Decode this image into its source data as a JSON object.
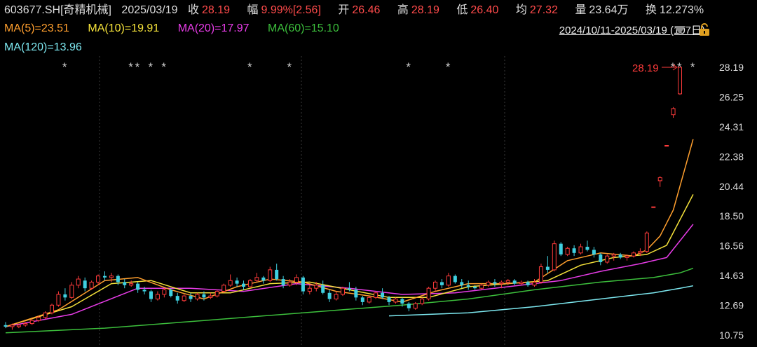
{
  "header": {
    "code": "603677.SH[奇精机械]",
    "date": "2025/03/19",
    "close_label": "收",
    "close": "28.19",
    "change_label": "幅",
    "change": "9.99%[2.56]",
    "open_label": "开",
    "open": "26.46",
    "high_label": "高",
    "high": "28.19",
    "low_label": "低",
    "low": "26.40",
    "avg_label": "均",
    "avg": "27.32",
    "vol_label": "量",
    "vol": "23.64万",
    "turnover_label": "换",
    "turnover": "12.273%"
  },
  "ma_legend": {
    "ma5": "MA(5)=23.51",
    "ma10": "MA(10)=19.91",
    "ma20": "MA(20)=17.97",
    "ma60": "MA(60)=15.10",
    "ma120": "MA(120)=13.96"
  },
  "range_label": "2024/10/11-2025/03/19 (107日)",
  "last_price_tag": "28.19",
  "colors": {
    "up": "#ff3b3b",
    "down": "#3fd0e0",
    "ma5": "#ff9f2e",
    "ma10": "#f5e23a",
    "ma20": "#e83ce8",
    "ma60": "#3cbf3c",
    "ma120": "#7de8f0"
  },
  "chart_data": {
    "type": "candlestick",
    "y_ticks": [
      "28.19",
      "26.25",
      "24.31",
      "22.38",
      "20.44",
      "18.50",
      "16.56",
      "14.63",
      "12.69",
      "10.75"
    ],
    "ylim": [
      10.75,
      28.19
    ],
    "markers": [
      "*",
      "*",
      "*",
      "*",
      "*",
      "*",
      "*",
      "*",
      "*",
      "*",
      "*",
      "*"
    ],
    "candles": [
      [
        11.4,
        11.6,
        11.2,
        11.3
      ],
      [
        11.3,
        11.5,
        11.1,
        11.4
      ],
      [
        11.3,
        11.5,
        11.2,
        11.4
      ],
      [
        11.4,
        11.6,
        11.3,
        11.5
      ],
      [
        11.5,
        11.8,
        11.4,
        11.7
      ],
      [
        11.7,
        12.0,
        11.6,
        11.9
      ],
      [
        11.9,
        12.3,
        11.8,
        12.2
      ],
      [
        12.2,
        12.8,
        12.1,
        12.7
      ],
      [
        12.7,
        13.6,
        12.6,
        13.4
      ],
      [
        13.4,
        13.8,
        13.0,
        13.2
      ],
      [
        13.2,
        14.2,
        13.1,
        14.0
      ],
      [
        14.0,
        14.6,
        13.8,
        14.4
      ],
      [
        14.3,
        14.5,
        13.6,
        13.8
      ],
      [
        13.8,
        14.3,
        13.7,
        14.2
      ],
      [
        14.2,
        14.7,
        14.0,
        14.6
      ],
      [
        14.6,
        14.9,
        14.3,
        14.5
      ],
      [
        14.5,
        14.8,
        14.2,
        14.6
      ],
      [
        14.6,
        14.7,
        14.0,
        14.2
      ],
      [
        14.2,
        14.4,
        13.8,
        14.0
      ],
      [
        14.0,
        14.3,
        13.9,
        14.1
      ],
      [
        14.1,
        14.2,
        13.5,
        13.7
      ],
      [
        13.7,
        13.9,
        13.4,
        13.6
      ],
      [
        13.6,
        13.7,
        12.9,
        13.1
      ],
      [
        13.1,
        13.6,
        13.0,
        13.4
      ],
      [
        13.4,
        13.8,
        13.2,
        13.7
      ],
      [
        13.7,
        13.8,
        13.2,
        13.3
      ],
      [
        13.3,
        13.5,
        12.8,
        13.0
      ],
      [
        13.0,
        13.4,
        12.9,
        13.3
      ],
      [
        13.3,
        13.5,
        12.9,
        13.1
      ],
      [
        13.1,
        13.5,
        13.0,
        13.4
      ],
      [
        13.4,
        13.6,
        13.0,
        13.2
      ],
      [
        13.2,
        13.5,
        13.1,
        13.3
      ],
      [
        13.3,
        13.7,
        13.2,
        13.6
      ],
      [
        13.6,
        14.1,
        13.5,
        14.0
      ],
      [
        14.0,
        14.7,
        13.9,
        14.3
      ],
      [
        14.3,
        14.5,
        13.9,
        14.1
      ],
      [
        14.1,
        14.3,
        13.7,
        13.9
      ],
      [
        13.9,
        14.4,
        13.8,
        14.3
      ],
      [
        14.3,
        14.8,
        14.2,
        14.5
      ],
      [
        14.5,
        14.6,
        14.1,
        14.3
      ],
      [
        14.3,
        15.2,
        14.2,
        15.0
      ],
      [
        15.0,
        15.4,
        14.3,
        14.4
      ],
      [
        14.4,
        14.6,
        13.8,
        14.0
      ],
      [
        14.0,
        14.4,
        13.9,
        14.2
      ],
      [
        14.2,
        14.7,
        14.0,
        14.5
      ],
      [
        14.5,
        14.6,
        13.4,
        13.6
      ],
      [
        13.6,
        14.0,
        13.4,
        13.8
      ],
      [
        13.8,
        14.2,
        13.6,
        14.0
      ],
      [
        14.0,
        14.3,
        13.4,
        13.5
      ],
      [
        13.5,
        13.7,
        12.9,
        13.1
      ],
      [
        13.1,
        13.6,
        13.0,
        13.4
      ],
      [
        13.4,
        13.9,
        13.3,
        13.8
      ],
      [
        13.8,
        14.2,
        13.6,
        13.7
      ],
      [
        13.7,
        13.9,
        13.0,
        13.2
      ],
      [
        13.2,
        13.3,
        12.7,
        12.9
      ],
      [
        12.9,
        13.3,
        12.8,
        13.2
      ],
      [
        13.2,
        13.6,
        13.1,
        13.5
      ],
      [
        13.5,
        13.8,
        13.1,
        13.2
      ],
      [
        13.2,
        13.3,
        12.7,
        12.9
      ],
      [
        12.9,
        13.2,
        12.8,
        13.1
      ],
      [
        13.1,
        13.2,
        12.6,
        12.8
      ],
      [
        12.8,
        12.9,
        12.3,
        12.5
      ],
      [
        12.5,
        12.9,
        12.4,
        12.8
      ],
      [
        12.8,
        13.2,
        12.7,
        13.1
      ],
      [
        13.1,
        13.9,
        13.0,
        13.8
      ],
      [
        13.8,
        14.3,
        13.6,
        14.2
      ],
      [
        14.2,
        14.4,
        13.8,
        14.0
      ],
      [
        14.0,
        14.8,
        13.9,
        14.6
      ],
      [
        14.6,
        14.7,
        14.1,
        14.2
      ],
      [
        14.2,
        14.4,
        13.8,
        14.0
      ],
      [
        14.0,
        14.3,
        13.7,
        13.9
      ],
      [
        13.9,
        14.0,
        13.7,
        13.8
      ],
      [
        13.8,
        14.1,
        13.7,
        14.0
      ],
      [
        14.0,
        14.3,
        13.9,
        14.2
      ],
      [
        14.2,
        14.4,
        13.9,
        14.1
      ],
      [
        14.1,
        14.3,
        13.8,
        14.2
      ],
      [
        14.2,
        14.4,
        14.0,
        14.3
      ],
      [
        14.3,
        14.4,
        14.0,
        14.1
      ],
      [
        14.1,
        14.3,
        14.0,
        14.2
      ],
      [
        14.2,
        14.3,
        13.9,
        14.0
      ],
      [
        14.0,
        14.4,
        13.9,
        14.2
      ],
      [
        14.2,
        15.4,
        14.1,
        15.2
      ],
      [
        15.2,
        15.9,
        14.8,
        15.0
      ],
      [
        15.0,
        16.9,
        14.9,
        16.7
      ],
      [
        16.7,
        16.8,
        15.9,
        16.0
      ],
      [
        16.0,
        16.5,
        15.9,
        16.4
      ],
      [
        16.4,
        16.6,
        15.9,
        16.1
      ],
      [
        16.1,
        16.7,
        16.0,
        16.5
      ],
      [
        16.5,
        16.9,
        16.2,
        16.3
      ],
      [
        16.3,
        16.5,
        15.8,
        16.0
      ],
      [
        16.0,
        16.1,
        15.3,
        15.5
      ],
      [
        15.5,
        16.0,
        15.4,
        15.9
      ],
      [
        15.9,
        16.1,
        15.6,
        16.0
      ],
      [
        16.0,
        16.1,
        15.7,
        15.8
      ],
      [
        15.8,
        16.0,
        15.6,
        15.9
      ],
      [
        15.9,
        16.2,
        15.8,
        16.1
      ],
      [
        16.1,
        16.4,
        15.9,
        16.2
      ],
      [
        16.2,
        17.5,
        16.1,
        17.4
      ],
      [
        19.1,
        19.1,
        19.1,
        19.1
      ],
      [
        20.8,
        21.1,
        20.4,
        21.0
      ],
      [
        23.1,
        23.1,
        23.1,
        23.1
      ],
      [
        25.1,
        25.6,
        24.9,
        25.5
      ],
      [
        26.46,
        28.19,
        26.4,
        28.19
      ]
    ],
    "ma_series": {
      "ma5": [
        [
          0,
          11.3
        ],
        [
          8,
          12.4
        ],
        [
          15,
          14.3
        ],
        [
          20,
          14.5
        ],
        [
          25,
          13.7
        ],
        [
          30,
          13.1
        ],
        [
          35,
          13.9
        ],
        [
          40,
          14.4
        ],
        [
          45,
          14.2
        ],
        [
          50,
          13.6
        ],
        [
          55,
          13.3
        ],
        [
          60,
          12.9
        ],
        [
          65,
          13.6
        ],
        [
          70,
          14.1
        ],
        [
          75,
          14.1
        ],
        [
          80,
          14.2
        ],
        [
          85,
          15.6
        ],
        [
          90,
          16.1
        ],
        [
          95,
          15.9
        ],
        [
          97,
          16.3
        ],
        [
          99,
          17.2
        ],
        [
          101,
          18.9
        ],
        [
          104,
          23.51
        ]
      ],
      "ma10": [
        [
          0,
          11.3
        ],
        [
          10,
          12.6
        ],
        [
          16,
          14.1
        ],
        [
          22,
          14.3
        ],
        [
          28,
          13.5
        ],
        [
          34,
          13.5
        ],
        [
          40,
          14.1
        ],
        [
          46,
          14.2
        ],
        [
          52,
          13.7
        ],
        [
          58,
          13.2
        ],
        [
          64,
          13.2
        ],
        [
          70,
          13.9
        ],
        [
          76,
          14.1
        ],
        [
          82,
          14.3
        ],
        [
          87,
          15.3
        ],
        [
          92,
          15.8
        ],
        [
          97,
          16.0
        ],
        [
          100,
          16.6
        ],
        [
          104,
          19.91
        ]
      ],
      "ma20": [
        [
          0,
          11.3
        ],
        [
          10,
          12.1
        ],
        [
          20,
          13.8
        ],
        [
          28,
          13.8
        ],
        [
          36,
          13.6
        ],
        [
          44,
          14.1
        ],
        [
          52,
          13.8
        ],
        [
          60,
          13.4
        ],
        [
          68,
          13.5
        ],
        [
          76,
          13.9
        ],
        [
          84,
          14.3
        ],
        [
          90,
          14.9
        ],
        [
          96,
          15.4
        ],
        [
          100,
          15.8
        ],
        [
          104,
          17.97
        ]
      ],
      "ma60": [
        [
          0,
          10.9
        ],
        [
          15,
          11.2
        ],
        [
          30,
          11.7
        ],
        [
          45,
          12.2
        ],
        [
          60,
          12.7
        ],
        [
          70,
          13.1
        ],
        [
          80,
          13.7
        ],
        [
          90,
          14.2
        ],
        [
          98,
          14.5
        ],
        [
          102,
          14.8
        ],
        [
          104,
          15.1
        ]
      ],
      "ma120": [
        [
          58,
          12.0
        ],
        [
          70,
          12.2
        ],
        [
          80,
          12.6
        ],
        [
          90,
          13.1
        ],
        [
          98,
          13.5
        ],
        [
          102,
          13.8
        ],
        [
          104,
          13.96
        ]
      ]
    }
  }
}
